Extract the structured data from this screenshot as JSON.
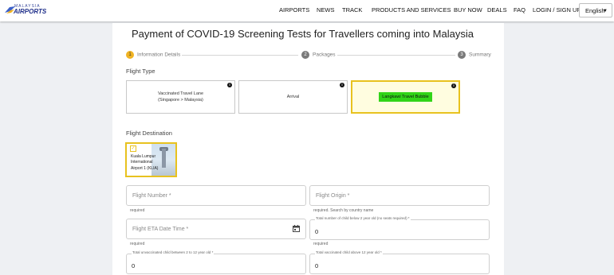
{
  "header": {
    "logo_small": "MALAYSIA",
    "logo_big": "AIRPORTS",
    "nav": [
      "AIRPORTS",
      "NEWS",
      "TRACK",
      "PRODUCTS AND SERVICES",
      "BUY NOW",
      "DEALS",
      "FAQ",
      "LOGIN / SIGN UP"
    ],
    "language": "English"
  },
  "page": {
    "title": "Payment of COVID-19 Screening Tests for Travellers coming into Malaysia"
  },
  "steps": [
    {
      "num": "1",
      "label": "Information Details"
    },
    {
      "num": "2",
      "label": "Packages"
    },
    {
      "num": "3",
      "label": "Summary"
    }
  ],
  "flight_type": {
    "label": "Flight Type",
    "options": [
      {
        "line1": "Vaccinated Travel Lane",
        "line2": "(Singapore > Malaysia)"
      },
      {
        "line1": "Arrival"
      },
      {
        "line1": "Langkawi Travel Bubble"
      }
    ]
  },
  "flight_destination": {
    "label": "Flight Destination",
    "card_label": "Kuala Lumpur International Airport 1 (KLIA)"
  },
  "form": {
    "flight_number": {
      "placeholder": "Flight Number *",
      "helper": "required"
    },
    "flight_origin": {
      "placeholder": "Flight Origin *",
      "helper": "required. Search by country name"
    },
    "flight_eta": {
      "placeholder": "Flight ETA Date Time *",
      "helper": "required"
    },
    "child_below_2": {
      "label": "Total number of child below 2 year old (no seats required) *",
      "value": "0",
      "helper": "required"
    },
    "unvaccinated_child": {
      "label": "Total unvaccinated child between 2 to 12 year old *",
      "value": "0"
    },
    "vaccinated_child": {
      "label": "Total vaccinated child above 12 year old *",
      "value": "0"
    }
  },
  "colors": {
    "accent": "#f0b323",
    "selected_border": "#e8c21f",
    "highlight": "#32d418"
  }
}
